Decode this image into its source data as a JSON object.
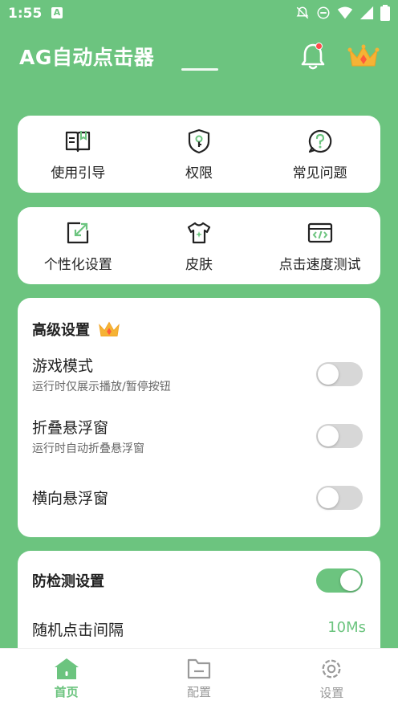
{
  "status_bar": {
    "time": "1:55",
    "indicator": "A"
  },
  "header": {
    "title": "AG自动点击器"
  },
  "quick_grid_1": [
    {
      "label": "使用引导",
      "icon": "book-icon"
    },
    {
      "label": "权限",
      "icon": "key-shield-icon"
    },
    {
      "label": "常见问题",
      "icon": "question-icon"
    }
  ],
  "quick_grid_2": [
    {
      "label": "个性化设置",
      "icon": "resize-icon"
    },
    {
      "label": "皮肤",
      "icon": "shirt-icon"
    },
    {
      "label": "点击速度测试",
      "icon": "code-window-icon"
    }
  ],
  "advanced": {
    "title": "高级设置",
    "game_mode": {
      "name": "游戏模式",
      "desc": "运行时仅展示播放/暂停按钮",
      "on": false
    },
    "fold_float": {
      "name": "折叠悬浮窗",
      "desc": "运行时自动折叠悬浮窗",
      "on": false
    },
    "horizontal_float": {
      "name": "横向悬浮窗",
      "on": false
    }
  },
  "anti_detect": {
    "title": "防检测设置",
    "on": true,
    "random_interval": {
      "name": "随机点击间隔",
      "value": "10Ms"
    }
  },
  "bottom_nav": [
    {
      "label": "首页",
      "active": true
    },
    {
      "label": "配置",
      "active": false
    },
    {
      "label": "设置",
      "active": false
    }
  ],
  "colors": {
    "brand": "#6cc47f",
    "accent": "#ff4a4a",
    "gold": "#f5b335"
  }
}
